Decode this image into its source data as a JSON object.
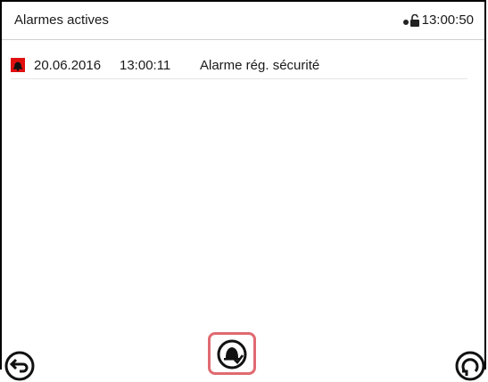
{
  "header": {
    "title": "Alarmes actives",
    "clock": "13:00:50",
    "lock_icon": "lock-open-icon"
  },
  "alarms": [
    {
      "icon": "alarm-bell-icon",
      "icon_color": "#e01010",
      "date": "20.06.2016",
      "time": "13:00:11",
      "text": "Alarme rég. sécurité"
    }
  ],
  "footer": {
    "back_icon": "back-arrow-icon",
    "ack_icon": "acknowledge-alarm-icon",
    "refresh_icon": "refresh-icon",
    "highlight_color": "#e06a72"
  }
}
